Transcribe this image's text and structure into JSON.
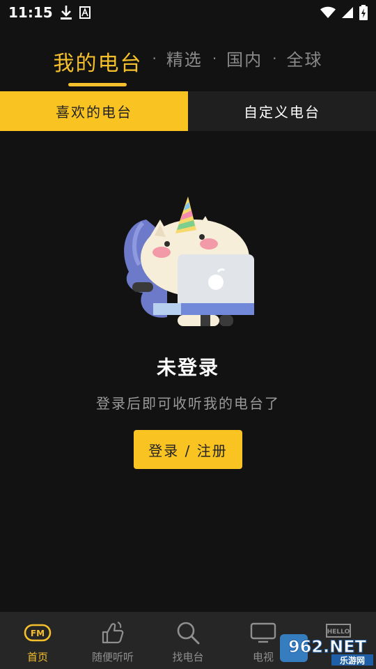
{
  "status": {
    "time": "11:15"
  },
  "tabs": [
    {
      "label": "我的电台",
      "active": true
    },
    {
      "label": "精选",
      "active": false
    },
    {
      "label": "国内",
      "active": false
    },
    {
      "label": "全球",
      "active": false
    }
  ],
  "tab_separator": "·",
  "segment": {
    "left": "喜欢的电台",
    "right": "自定义电台"
  },
  "empty": {
    "title": "未登录",
    "subtitle": "登录后即可收听我的电台了",
    "button": "登录 / 注册"
  },
  "bottom_nav": [
    {
      "label": "首页",
      "icon": "fm-icon",
      "active": true
    },
    {
      "label": "随便听听",
      "icon": "thumbs-up-icon",
      "active": false
    },
    {
      "label": "找电台",
      "icon": "search-icon",
      "active": false
    },
    {
      "label": "电视",
      "icon": "tv-icon",
      "active": false
    },
    {
      "label": "",
      "icon": "hello-icon",
      "active": false
    }
  ],
  "fm_icon_text": "FM",
  "hello_icon_text": "HELLO",
  "watermark": {
    "brand": "962.NET",
    "sub": "乐游网"
  },
  "colors": {
    "accent": "#f9c322",
    "background": "#121212",
    "nav_bg": "#262626"
  }
}
